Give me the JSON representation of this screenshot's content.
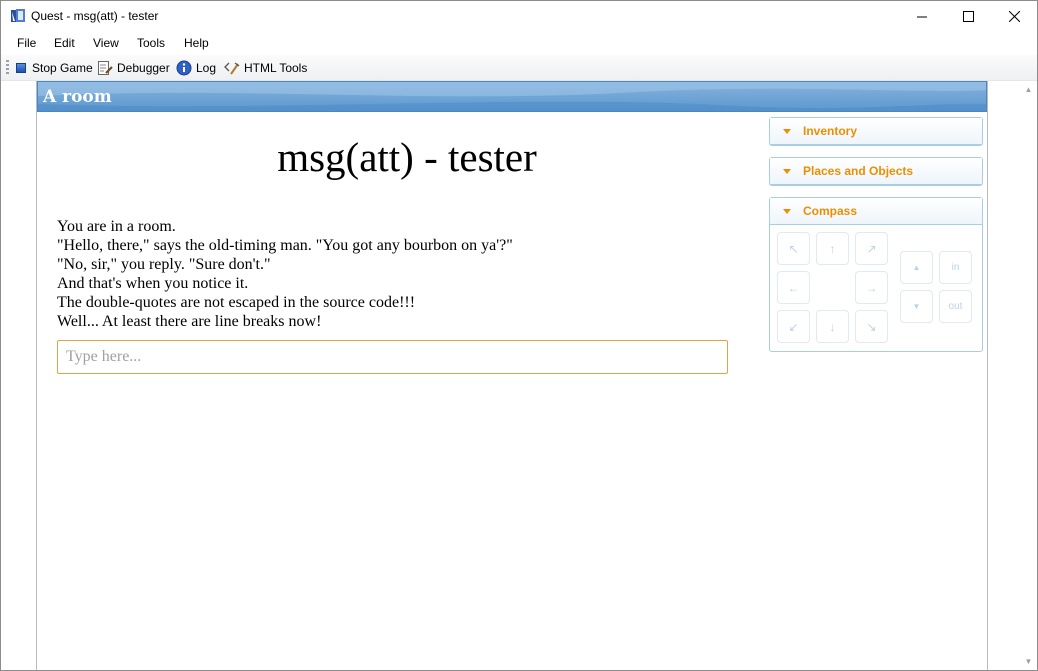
{
  "window": {
    "title": "Quest - msg(att) - tester",
    "controls": {
      "minimize": "—",
      "maximize": "☐",
      "close": "✕"
    }
  },
  "menu": [
    "File",
    "Edit",
    "View",
    "Tools",
    "Help"
  ],
  "toolbar": {
    "stop_game": "Stop Game",
    "debugger": "Debugger",
    "log": "Log",
    "html_tools": "HTML Tools"
  },
  "room": {
    "header": "A room"
  },
  "game": {
    "title": "msg(att) - tester",
    "output": [
      "You are in a room.",
      "\"Hello, there,\" says the old-timing man. \"You got any bourbon on ya'?\"",
      "\"No, sir,\" you reply. \"Sure don't.\"",
      "And that's when you notice it.",
      "The double-quotes are not escaped in the source code!!!",
      "Well... At least there are line breaks now!"
    ],
    "input_placeholder": "Type here..."
  },
  "panels": {
    "inventory": "Inventory",
    "places": "Places and Objects",
    "compass": "Compass"
  },
  "compass": {
    "nw": "↖",
    "n": "↑",
    "ne": "↗",
    "w": "←",
    "e": "→",
    "sw": "↙",
    "s": "↓",
    "se": "↘",
    "up": "▲",
    "down": "▼",
    "in": "in",
    "out": "out"
  },
  "colors": {
    "accent_orange": "#eb8f00",
    "header_blue": "#5c98d0",
    "panel_border": "#a9cde3",
    "compass_disabled": "#b9d4e8"
  }
}
